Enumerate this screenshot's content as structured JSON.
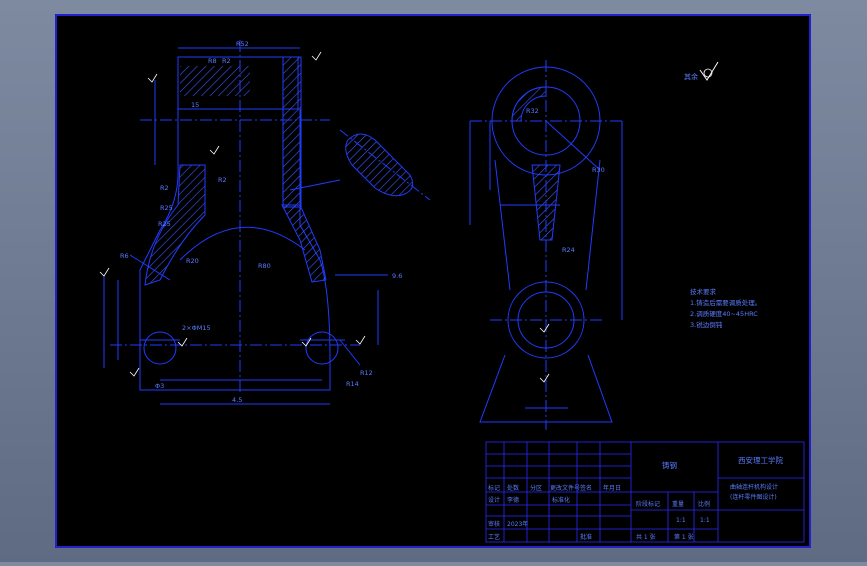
{
  "colors": {
    "background": "#000000",
    "frame": "#2a2aff",
    "line": "#1f3cff",
    "hatch": "#3c5aff",
    "text": "#5a7cff",
    "white": "#ffffff"
  },
  "drawing": {
    "left_view": {
      "dims": [
        "R52",
        "R8",
        "R2",
        "15",
        "R2",
        "R2",
        "R25",
        "R25",
        "R20",
        "R80",
        "R6",
        "R12",
        "R14"
      ],
      "dim_callouts": [
        "2×ΦM15",
        "Φ3",
        "4.5",
        "9.6"
      ]
    },
    "right_view": {
      "dims": [
        "R32",
        "R30",
        "R24"
      ]
    },
    "notes": {
      "title": "技术要求",
      "lines": [
        "1.铸造后需要调质处理。",
        "2.调质硬度40~45HRC",
        "3.锐边倒钝"
      ]
    },
    "roughness_label": "其余"
  },
  "title_block": {
    "school": "西安理工学院",
    "material": "铸钢",
    "part_name_1": "曲轴连杆机构设计",
    "part_name_2": "(连杆零件图设计)",
    "header_labels": [
      "标记",
      "处数",
      "分区",
      "更改文件号",
      "签名",
      "年月日"
    ],
    "design_row": [
      "设计",
      "李德",
      "标准化"
    ],
    "review_row": [
      "审核",
      "2023年"
    ],
    "process_row": [
      "工艺",
      "批准"
    ],
    "stage_label": "阶段标记",
    "weight_label": "重量",
    "scale_label": "比例",
    "scale_value": "1:1",
    "sheet_total": "共 1 张",
    "sheet_no": "第 1 张",
    "unit": "1:1"
  }
}
